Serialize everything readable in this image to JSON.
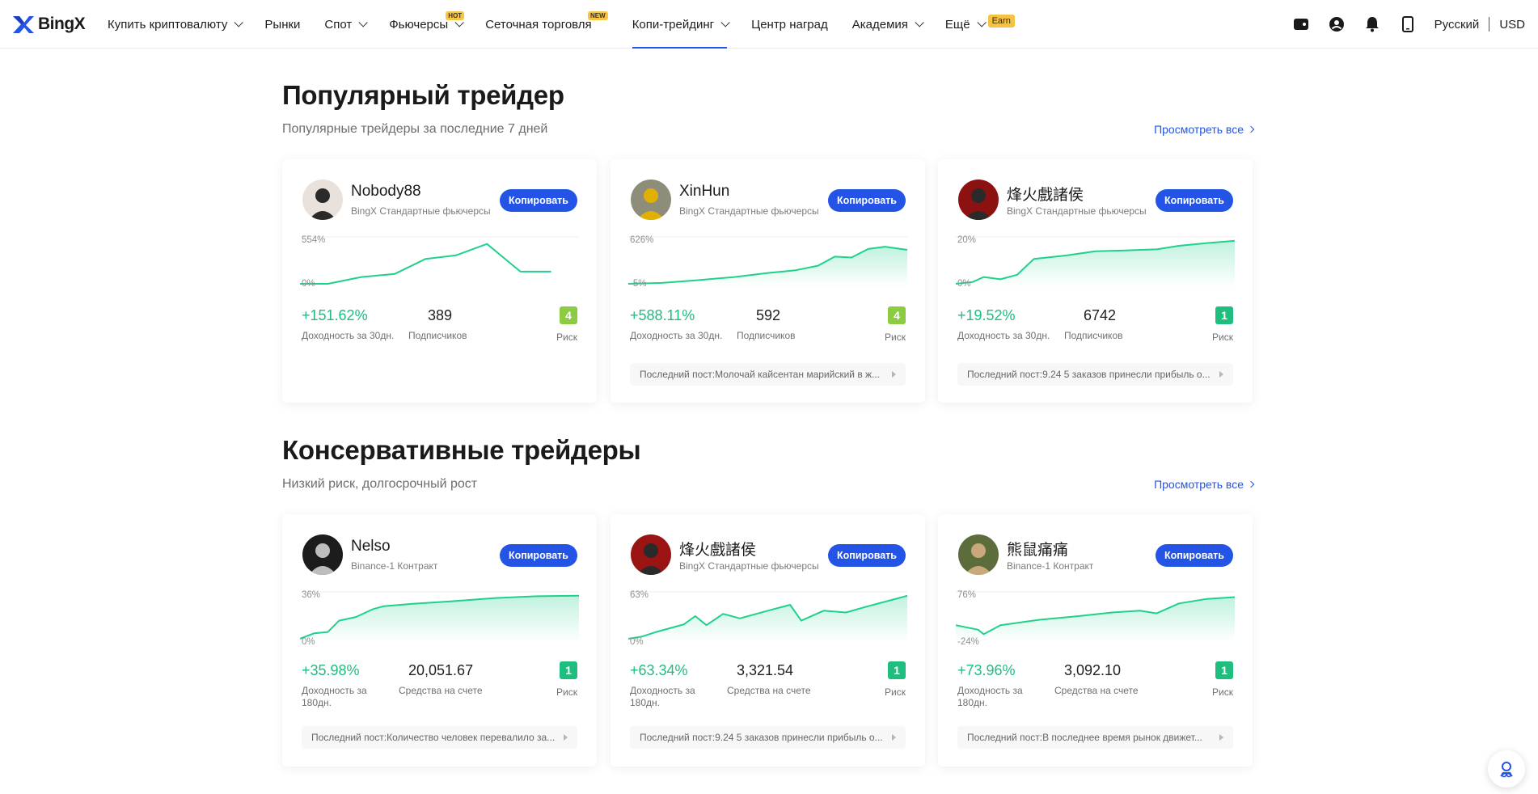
{
  "brand": {
    "name": "BingX"
  },
  "nav": [
    {
      "label": "Купить криптовалюту",
      "has_dropdown": true
    },
    {
      "label": "Рынки",
      "has_dropdown": false
    },
    {
      "label": "Спот",
      "has_dropdown": true
    },
    {
      "label": "Фьючерсы",
      "has_dropdown": true,
      "badge": "HOT"
    },
    {
      "label": "Сеточная торговля",
      "has_dropdown": false,
      "badge": "NEW"
    },
    {
      "label": "Копи-трейдинг",
      "has_dropdown": true,
      "active": true
    },
    {
      "label": "Центр наград",
      "has_dropdown": false
    },
    {
      "label": "Академия",
      "has_dropdown": true
    },
    {
      "label": "Ещё",
      "has_dropdown": true,
      "badge": "Earn"
    }
  ],
  "tools": {
    "icons": [
      "wallet-icon",
      "user-icon",
      "bell-icon",
      "phone-icon"
    ],
    "language": "Русский",
    "currency": "USD"
  },
  "colors": {
    "accent": "#2354e6",
    "positive": "#1fbd7e",
    "risk_low": "#1fbd7e",
    "risk_mid": "#8ccb42"
  },
  "sections": [
    {
      "title": "Популярный трейдер",
      "subtitle": "Популярные трейдеры за последние 7 дней",
      "view_all": "Просмотреть все",
      "cards": [
        {
          "name": "Nobody88",
          "platform": "BingX Стандартные фьючерсы",
          "copy_label": "Копировать",
          "chart_max": "554%",
          "chart_min": "0%",
          "return_value": "+151.62%",
          "return_label": "Доходность за 30дн.",
          "second_value": "389",
          "second_label": "Подписчиков",
          "risk": "4",
          "risk_label": "Риск",
          "post": ""
        },
        {
          "name": "XinHun",
          "platform": "BingX Стандартные фьючерсы",
          "copy_label": "Копировать",
          "chart_max": "626%",
          "chart_min": "-5%",
          "return_value": "+588.11%",
          "return_label": "Доходность за 30дн.",
          "second_value": "592",
          "second_label": "Подписчиков",
          "risk": "4",
          "risk_label": "Риск",
          "post": "Последний пост:Молочай кайсентан марийский в ж..."
        },
        {
          "name": "烽火戲諸侯",
          "platform": "BingX Стандартные фьючерсы",
          "copy_label": "Копировать",
          "chart_max": "20%",
          "chart_min": "0%",
          "return_value": "+19.52%",
          "return_label": "Доходность за 30дн.",
          "second_value": "6742",
          "second_label": "Подписчиков",
          "risk": "1",
          "risk_label": "Риск",
          "post": "Последний пост:9.24 5 заказов принесли прибыль о..."
        }
      ]
    },
    {
      "title": "Консервативные трейдеры",
      "subtitle": "Низкий риск, долгосрочный рост",
      "view_all": "Просмотреть все",
      "cards": [
        {
          "name": "Nelso",
          "platform": "Binance-1 Контракт",
          "copy_label": "Копировать",
          "chart_max": "36%",
          "chart_min": "0%",
          "return_value": "+35.98%",
          "return_label": "Доходность за 180дн.",
          "second_value": "20,051.67",
          "second_label": "Средства на счете",
          "risk": "1",
          "risk_label": "Риск",
          "post": "Последний пост:Количество человек перевалило за..."
        },
        {
          "name": "烽火戲諸侯",
          "platform": "BingX Стандартные фьючерсы",
          "copy_label": "Копировать",
          "chart_max": "63%",
          "chart_min": "0%",
          "return_value": "+63.34%",
          "return_label": "Доходность за 180дн.",
          "second_value": "3,321.54",
          "second_label": "Средства на счете",
          "risk": "1",
          "risk_label": "Риск",
          "post": "Последний пост:9.24 5 заказов принесли прибыль о..."
        },
        {
          "name": "熊鼠痛痛",
          "platform": "Binance-1 Контракт",
          "copy_label": "Копировать",
          "chart_max": "76%",
          "chart_min": "-24%",
          "return_value": "+73.96%",
          "return_label": "Доходность за 180дн.",
          "second_value": "3,092.10",
          "second_label": "Средства на счете",
          "risk": "1",
          "risk_label": "Риск",
          "post": "Последний пост:В последнее время рынок движет..."
        }
      ]
    }
  ]
}
